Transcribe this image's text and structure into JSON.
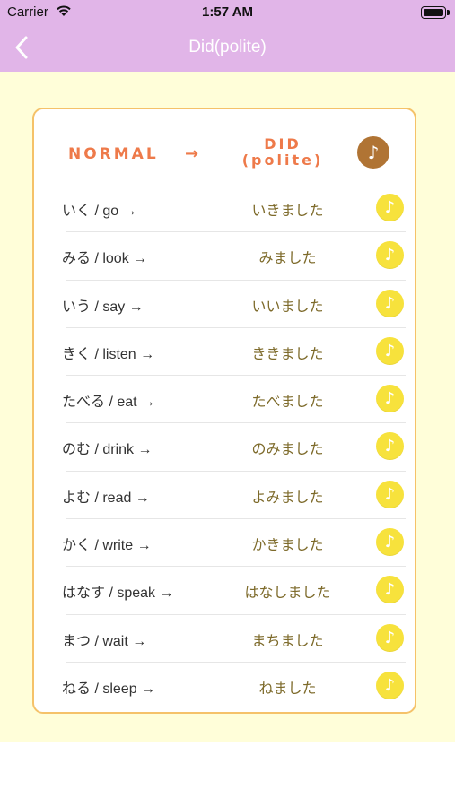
{
  "status": {
    "carrier": "Carrier",
    "time": "1:57 AM"
  },
  "nav": {
    "title": "Did(polite)"
  },
  "header": {
    "normal": "NORMAL",
    "arrow": "→",
    "did_line1": "DID",
    "did_line2": "(polite)",
    "play_glyph": "♪"
  },
  "rows": [
    {
      "word": "いく / go →",
      "polite": "いきました"
    },
    {
      "word": "みる / look →",
      "polite": "みました"
    },
    {
      "word": "いう / say →",
      "polite": "いいました"
    },
    {
      "word": "きく / listen →",
      "polite": "ききました"
    },
    {
      "word": "たべる / eat →",
      "polite": "たべました"
    },
    {
      "word": "のむ / drink →",
      "polite": "のみました"
    },
    {
      "word": "よむ / read →",
      "polite": "よみました"
    },
    {
      "word": "かく / write →",
      "polite": "かきました"
    },
    {
      "word": "はなす / speak →",
      "polite": "はなしました"
    },
    {
      "word": "まつ / wait →",
      "polite": "まちました"
    },
    {
      "word": "ねる / sleep →",
      "polite": "ねました"
    }
  ],
  "icons": {
    "row_play": "music-note-icon",
    "back": "chevron-left-icon",
    "wifi": "wifi-icon",
    "battery": "battery-icon"
  },
  "colors": {
    "nav_bg": "#e1b5e8",
    "content_bg": "#fffed9",
    "card_border": "#f5c269",
    "accent": "#ee7a4a",
    "play_yellow": "#f7e23c",
    "play_brown": "#b07434"
  }
}
